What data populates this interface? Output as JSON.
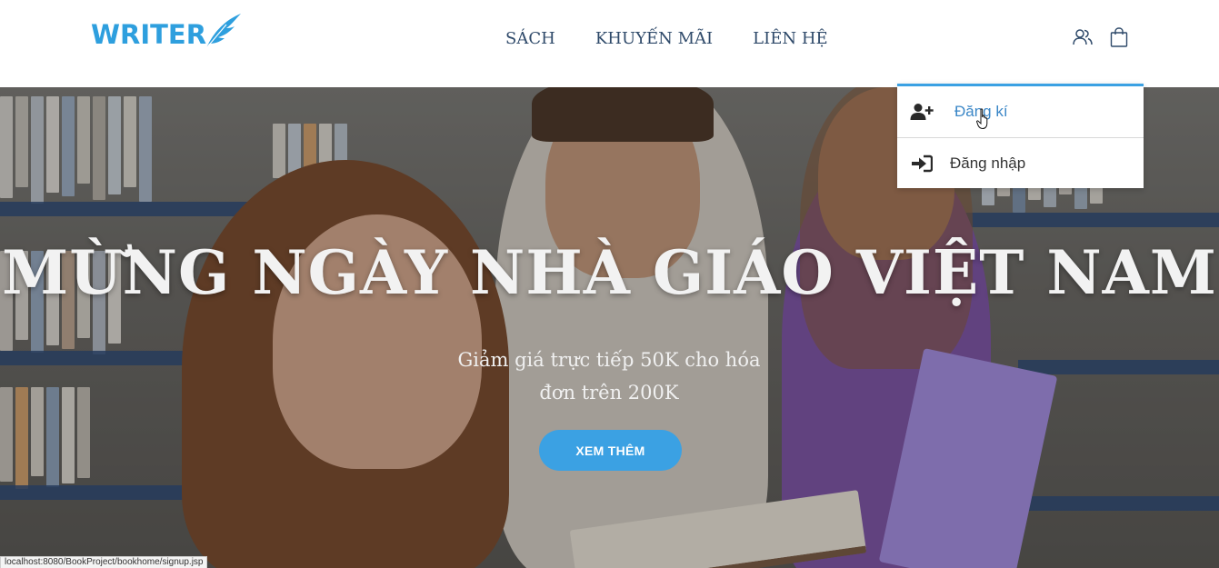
{
  "brand": {
    "logo_text": "WRITER",
    "accent_color": "#2e9fde"
  },
  "nav": {
    "items": [
      {
        "label": "SÁCH"
      },
      {
        "label": "KHUYẾN MÃI"
      },
      {
        "label": "LIÊN HỆ"
      }
    ]
  },
  "header_icons": {
    "user": "user-icon",
    "cart": "shopping-bag-icon"
  },
  "dropdown": {
    "items": [
      {
        "label": "Đăng kí",
        "icon": "user-plus-icon"
      },
      {
        "label": "Đăng nhập",
        "icon": "sign-in-icon"
      }
    ]
  },
  "hero": {
    "title": "MỪNG NGÀY NHÀ GIÁO VIỆT NAM",
    "subtitle": "Giảm giá trực tiếp 50K cho hóa đơn trên 200K",
    "button_label": "XEM THÊM",
    "button_color": "#3ba1e3"
  },
  "status_bar": {
    "url": "localhost:8080/BookProject/bookhome/signup.jsp"
  }
}
